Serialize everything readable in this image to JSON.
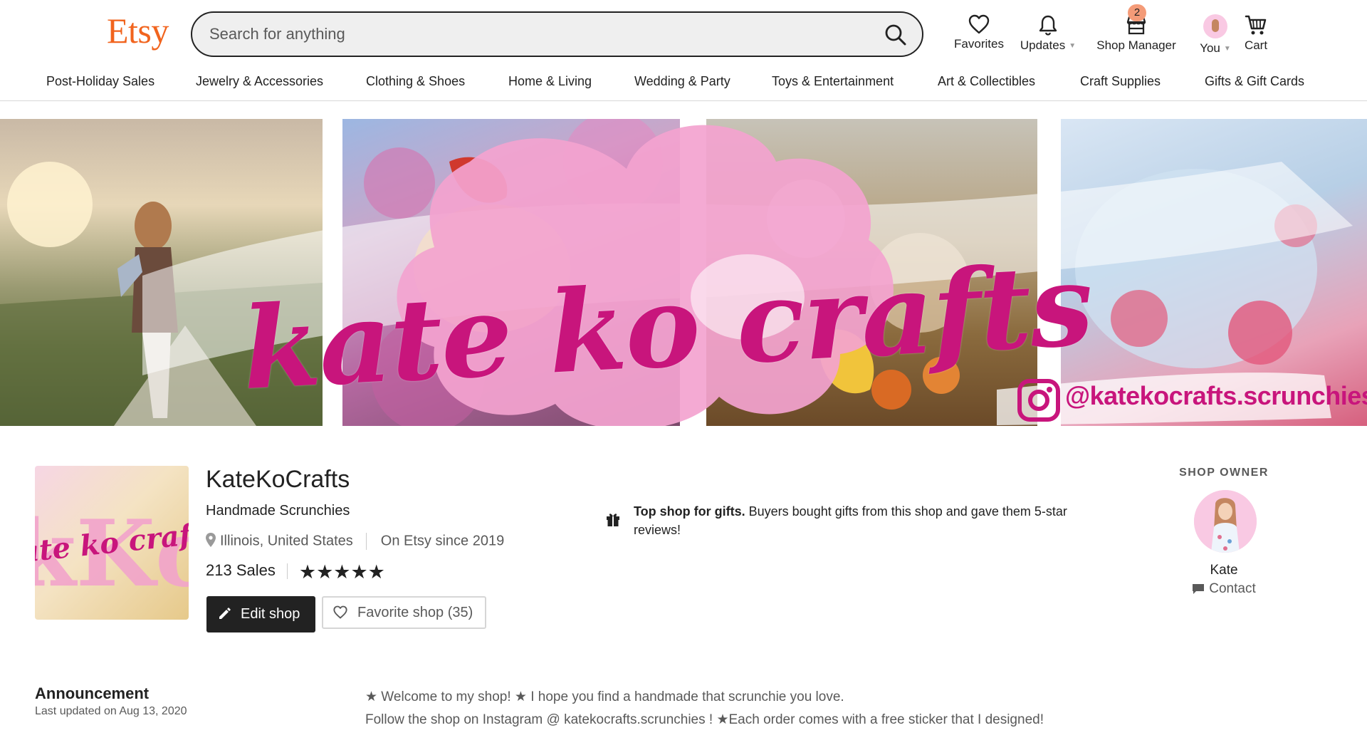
{
  "header": {
    "logo": "Etsy",
    "search": {
      "placeholder": "Search for anything",
      "value": ""
    },
    "nav": {
      "favorites": "Favorites",
      "updates": "Updates",
      "shop_manager": "Shop Manager",
      "shop_manager_badge": "2",
      "you": "You",
      "cart": "Cart"
    },
    "categories": [
      "Post-Holiday Sales",
      "Jewelry & Accessories",
      "Clothing & Shoes",
      "Home & Living",
      "Wedding & Party",
      "Toys & Entertainment",
      "Art & Collectibles",
      "Craft Supplies",
      "Gifts & Gift Cards"
    ]
  },
  "banner": {
    "title": "kate ko crafts",
    "instagram_handle": "@katekocrafts.scrunchies"
  },
  "shop": {
    "logo_text": "kate ko crafts",
    "logo_monogram": "kKc",
    "name": "KateKoCrafts",
    "tagline": "Handmade Scrunchies",
    "location": "Illinois, United States",
    "since": "On Etsy since 2019",
    "sales": "213 Sales",
    "rating_stars": 5,
    "stars_text": "★★★★★",
    "edit_button": "Edit shop",
    "favorite_button": "Favorite shop (35)",
    "gift_badge": {
      "bold": "Top shop for gifts.",
      "text": " Buyers bought gifts from this shop and gave them 5-star reviews!"
    }
  },
  "owner": {
    "heading": "SHOP OWNER",
    "name": "Kate",
    "contact": "Contact"
  },
  "announcement": {
    "title": "Announcement",
    "updated": "Last updated on Aug 13, 2020",
    "line1": "★ Welcome to my shop! ★ I hope you find a handmade that scrunchie you love.",
    "line2": "Follow the shop on Instagram @ katekocrafts.scrunchies ! ★Each order comes with a free sticker that I designed!"
  },
  "colors": {
    "etsy_orange": "#f1641e",
    "brand_magenta": "#c8157c",
    "brand_pink": "#f3a3cf",
    "badge_orange": "#f49b78"
  }
}
